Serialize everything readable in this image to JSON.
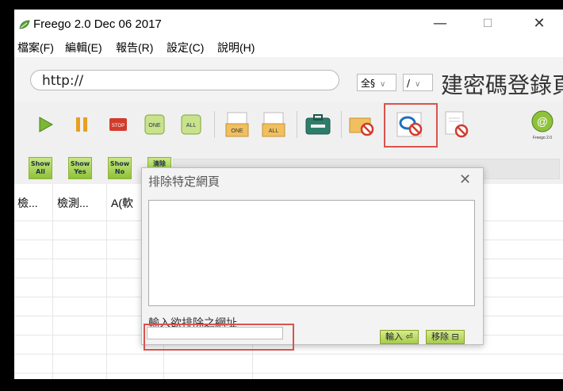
{
  "window": {
    "title": "Freego 2.0 Dec 06 2017",
    "minimize": "—",
    "maximize": "☐",
    "close": "✕"
  },
  "menu": [
    {
      "label": "檔案(F)"
    },
    {
      "label": "編輯(E)"
    },
    {
      "label": "報告(R)"
    },
    {
      "label": "設定(C)"
    },
    {
      "label": "說明(H)"
    }
  ],
  "urlbar": {
    "url_value": "http://",
    "encoding": "全§",
    "lang": "/",
    "banner_text": "建密碼登錄頁"
  },
  "toolbar": {
    "icons": [
      "play-icon",
      "pause-icon",
      "stop-icon",
      "refresh-one-icon",
      "refresh-all-icon",
      "folder-one-icon",
      "folder-all-icon",
      "toolbox-icon",
      "exclude-folder-icon",
      "exclude-ie-icon",
      "exclude-doc-icon",
      "freego-logo"
    ],
    "stop_label": "STOP",
    "one_label": "ONE",
    "all_label": "ALL",
    "logo_text": "Freego 2.0"
  },
  "subtool": {
    "buttons": [
      {
        "top": "Show",
        "bottom": "All"
      },
      {
        "top": "Show",
        "bottom": "Yes"
      },
      {
        "top": "Show",
        "bottom": "No"
      },
      {
        "top": "清除",
        "bottom": ""
      }
    ]
  },
  "table": {
    "columns": [
      "檢...",
      "檢測...",
      "A(軟"
    ]
  },
  "dialog": {
    "title": "排除特定網頁",
    "close": "✕",
    "input_label": "輸入欲排除之網址",
    "input_value": "",
    "add_button": "輸入 ⏎",
    "remove_button": "移除 ⊟"
  },
  "colors": {
    "accent_green": "#8fc23a",
    "highlight_red": "#d9534f"
  }
}
